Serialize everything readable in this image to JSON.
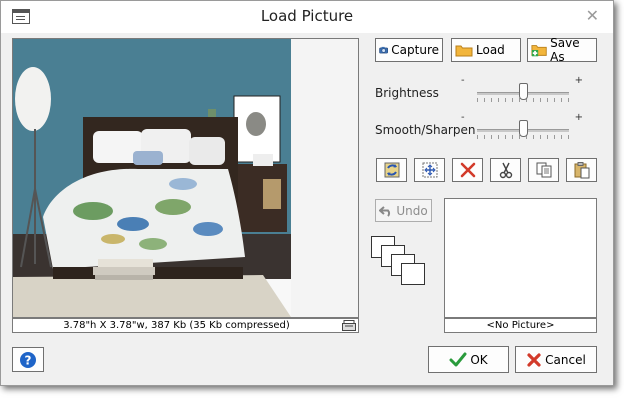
{
  "window": {
    "title": "Load Picture",
    "close_glyph": "✕"
  },
  "picture": {
    "info": "3.78\"h X 3.78\"w, 387 Kb (35 Kb compressed)",
    "status_icon": "scanner-icon"
  },
  "toolbar": {
    "capture_label": "Capture",
    "load_label": "Load",
    "save_as_label": "Save As"
  },
  "adjust": {
    "brightness_label": "Brightness",
    "brightness_value": 0.5,
    "smooth_label": "Smooth/Sharpen",
    "smooth_value": 0.5,
    "minus": "-",
    "plus": "+"
  },
  "tools": [
    {
      "name": "swap-icon"
    },
    {
      "name": "fit-icon"
    },
    {
      "name": "delete-icon"
    },
    {
      "name": "cut-icon"
    },
    {
      "name": "copy-icon"
    },
    {
      "name": "paste-icon"
    }
  ],
  "undo_label": "Undo",
  "preview": {
    "caption": "<No Picture>"
  },
  "footer": {
    "help_glyph": "?",
    "ok_label": "OK",
    "cancel_label": "Cancel"
  },
  "colors": {
    "wall": "#4a7f93",
    "ok_check": "#2a9b3c",
    "cancel_x": "#d23a2a",
    "help_blue": "#1e64c8"
  }
}
